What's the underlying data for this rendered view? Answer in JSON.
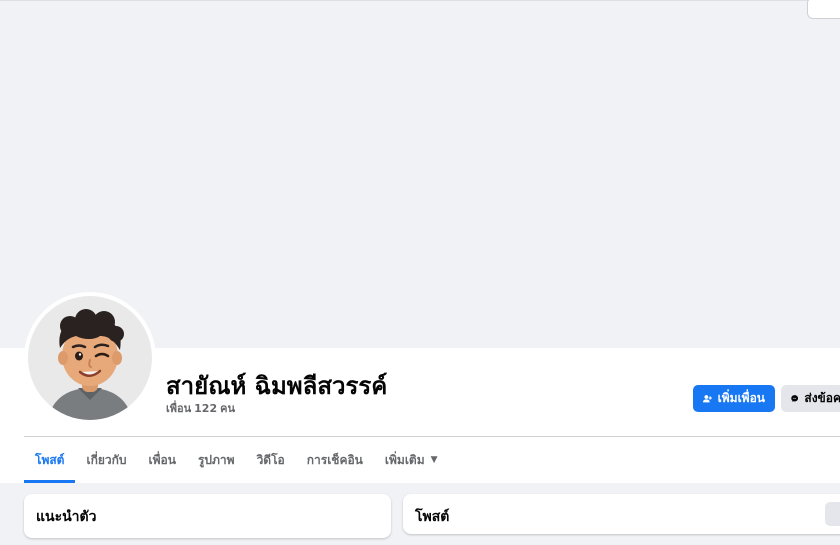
{
  "profile": {
    "name": "สายัณห์ ฉิมพลีสวรรค์",
    "friends_label": "เพื่อน",
    "friends_count": "122",
    "friends_unit": "คน"
  },
  "actions": {
    "add_friend": "เพิ่มเพื่อน",
    "message": "ส่งข้อค"
  },
  "tabs": [
    {
      "label": "โพสต์",
      "active": true
    },
    {
      "label": "เกี่ยวกับ"
    },
    {
      "label": "เพื่อน"
    },
    {
      "label": "รูปภาพ"
    },
    {
      "label": "วิดีโอ"
    },
    {
      "label": "การเช็คอิน"
    },
    {
      "label": "เพิ่มเติม"
    }
  ],
  "cards": {
    "intro_title": "แนะนำตัว",
    "posts_title": "โพสต์"
  },
  "colors": {
    "accent": "#1877f2",
    "background": "#f0f2f5"
  }
}
